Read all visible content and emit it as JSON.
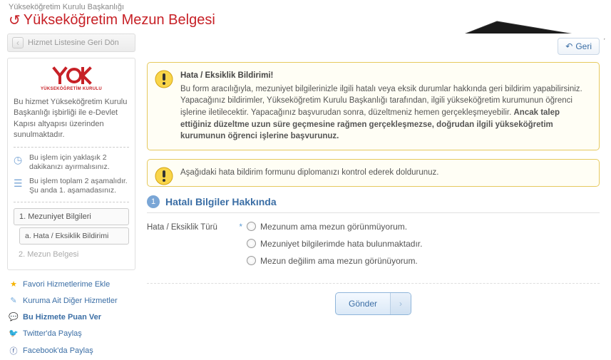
{
  "header": {
    "org": "Yükseköğretim Kurulu Başkanlığı",
    "title": "Yükseköğretim Mezun Belgesi"
  },
  "sidebar": {
    "back_label": "Hizmet Listesine Geri Dön",
    "logo_sub": "YÜKSEKÖĞRETİM KURULU",
    "desc": "Bu hizmet Yükseköğretim Kurulu Başkanlığı işbirliği ile e-Devlet Kapısı altyapısı üzerinden sunulmaktadır.",
    "info_time": "Bu işlem için yaklaşık 2 dakikanızı ayırmalısınız.",
    "info_steps": "Bu işlem toplam 2 aşamalıdır. Şu anda 1. aşamadasınız.",
    "nav": {
      "item1": "1. Mezuniyet Bilgileri",
      "item1a": "a. Hata / Eksiklik Bildirimi",
      "item2": "2. Mezun Belgesi"
    },
    "links": {
      "fav": "Favori Hizmetlerime Ekle",
      "other": "Kuruma Ait Diğer Hizmetler",
      "rate": "Bu Hizmete Puan Ver",
      "twitter": "Twitter'da Paylaş",
      "facebook": "Facebook'da Paylaş"
    }
  },
  "main": {
    "back_btn": "Geri",
    "notice1_title": "Hata / Eksiklik Bildirimi!",
    "notice1_body_a": "Bu form aracılığıyla, mezuniyet bilgilerinizle ilgili hatalı veya eksik durumlar hakkında geri bildirim yapabilirsiniz. Yapacağınız bildirimler, Yükseköğretim Kurulu Başkanlığı tarafından, ilgili yükseköğretim kurumunun öğrenci işlerine iletilecektir. Yapacağınız başvurudan sonra, düzeltmeniz hemen gerçekleşmeyebilir. ",
    "notice1_body_b": "Ancak talep ettiğiniz düzeltme uzun süre geçmesine rağmen gerçekleşmezse, doğrudan ilgili yükseköğretim kurumunun öğrenci işlerine başvurunuz.",
    "notice2": "Aşağıdaki hata bildirim formunu diplomanızı kontrol ederek doldurunuz.",
    "step_num": "1",
    "step_title": "Hatalı Bilgiler Hakkında",
    "form_label": "Hata / Eksiklik Türü",
    "options": {
      "o1": "Mezunum ama mezun görünmüyorum.",
      "o2": "Mezuniyet bilgilerimde hata bulunmaktadır.",
      "o3": "Mezun değilim ama mezun görünüyorum."
    },
    "submit": "Gönder"
  }
}
